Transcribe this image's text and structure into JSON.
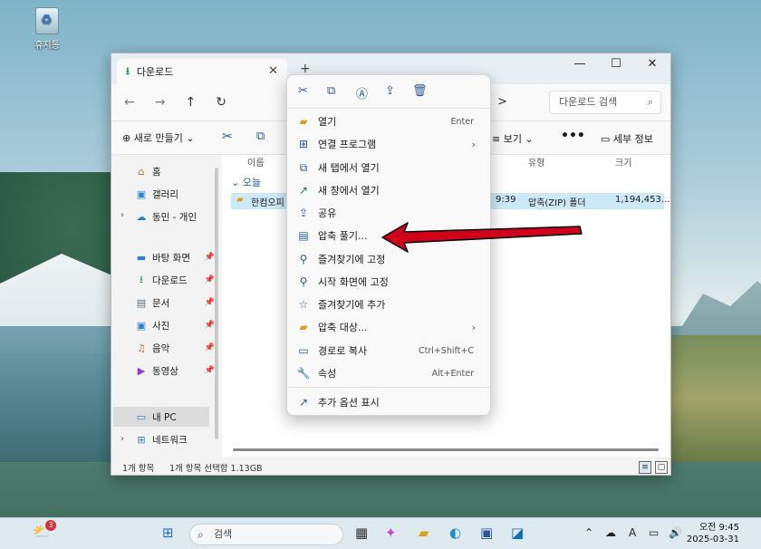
{
  "desktop": {
    "recycle_bin_label": "휴지통"
  },
  "window": {
    "tab_title": "다운로드",
    "new_tab": "+",
    "controls": {
      "minimize": "—",
      "maximize": "☐",
      "close": "✕"
    },
    "nav": {
      "back": "←",
      "forward": "→",
      "up": "↑",
      "refresh": "↻"
    },
    "crumb_chevron": ">",
    "search_placeholder": "다운로드 검색",
    "toolbar": {
      "new": "새로 만들기",
      "view": "보기",
      "more": "•••",
      "details": "세부 정보"
    }
  },
  "sidebar": {
    "items": [
      {
        "label": "홈",
        "icon": "home-icon"
      },
      {
        "label": "갤러리",
        "icon": "gallery-icon"
      },
      {
        "label": "동민 - 개인",
        "icon": "onedrive-icon"
      },
      {
        "label": "바탕 화면",
        "icon": "desktop-icon"
      },
      {
        "label": "다운로드",
        "icon": "download-icon"
      },
      {
        "label": "문서",
        "icon": "document-icon"
      },
      {
        "label": "사진",
        "icon": "pictures-icon"
      },
      {
        "label": "음악",
        "icon": "music-icon"
      },
      {
        "label": "동영상",
        "icon": "video-icon"
      },
      {
        "label": "내 PC",
        "icon": "pc-icon"
      },
      {
        "label": "네트워크",
        "icon": "network-icon"
      }
    ]
  },
  "content": {
    "headers": {
      "name": "이름",
      "type": "유형",
      "size": "크기"
    },
    "group": "오늘",
    "row": {
      "name": "한컴오피",
      "time": "9:39",
      "type": "압축(ZIP) 폴더",
      "size": "1,194,453..."
    }
  },
  "status": {
    "count": "1개 항목",
    "selected": "1개 항목 선택함 1.13GB"
  },
  "context_menu": {
    "quick_actions": [
      "cut-icon",
      "copy-icon",
      "rename-icon",
      "share-icon",
      "delete-icon"
    ],
    "items": [
      {
        "label": "열기",
        "shortcut": "Enter",
        "icon": "folder-open-icon"
      },
      {
        "label": "연결 프로그램",
        "shortcut": "",
        "icon": "open-with-icon"
      },
      {
        "label": "새 탭에서 열기",
        "shortcut": "",
        "icon": "new-tab-icon"
      },
      {
        "label": "새 창에서 열기",
        "shortcut": "",
        "icon": "new-window-icon"
      },
      {
        "label": "공유",
        "shortcut": "",
        "icon": "share-icon"
      },
      {
        "label": "압축 풀기...",
        "shortcut": "",
        "icon": "extract-icon"
      },
      {
        "label": "즐겨찾기에 고정",
        "shortcut": "",
        "icon": "pin-icon"
      },
      {
        "label": "시작 화면에 고정",
        "shortcut": "",
        "icon": "pin-start-icon"
      },
      {
        "label": "즐겨찾기에 추가",
        "shortcut": "",
        "icon": "star-icon"
      },
      {
        "label": "압축 대상...",
        "shortcut": "",
        "icon": "compress-icon"
      },
      {
        "label": "경로로 복사",
        "shortcut": "Ctrl+Shift+C",
        "icon": "copy-path-icon"
      },
      {
        "label": "속성",
        "shortcut": "Alt+Enter",
        "icon": "properties-icon"
      },
      {
        "label": "추가 옵션 표시",
        "shortcut": "",
        "icon": "more-options-icon"
      }
    ]
  },
  "taskbar": {
    "weather_badge": "3",
    "search_label": "검색",
    "clock_time": "오전 9:45",
    "clock_date": "2025-03-31",
    "ime_label": "A"
  },
  "colors": {
    "accent": "#2b579a",
    "selection": "#cde8f7",
    "arrow": "#d0021b"
  }
}
